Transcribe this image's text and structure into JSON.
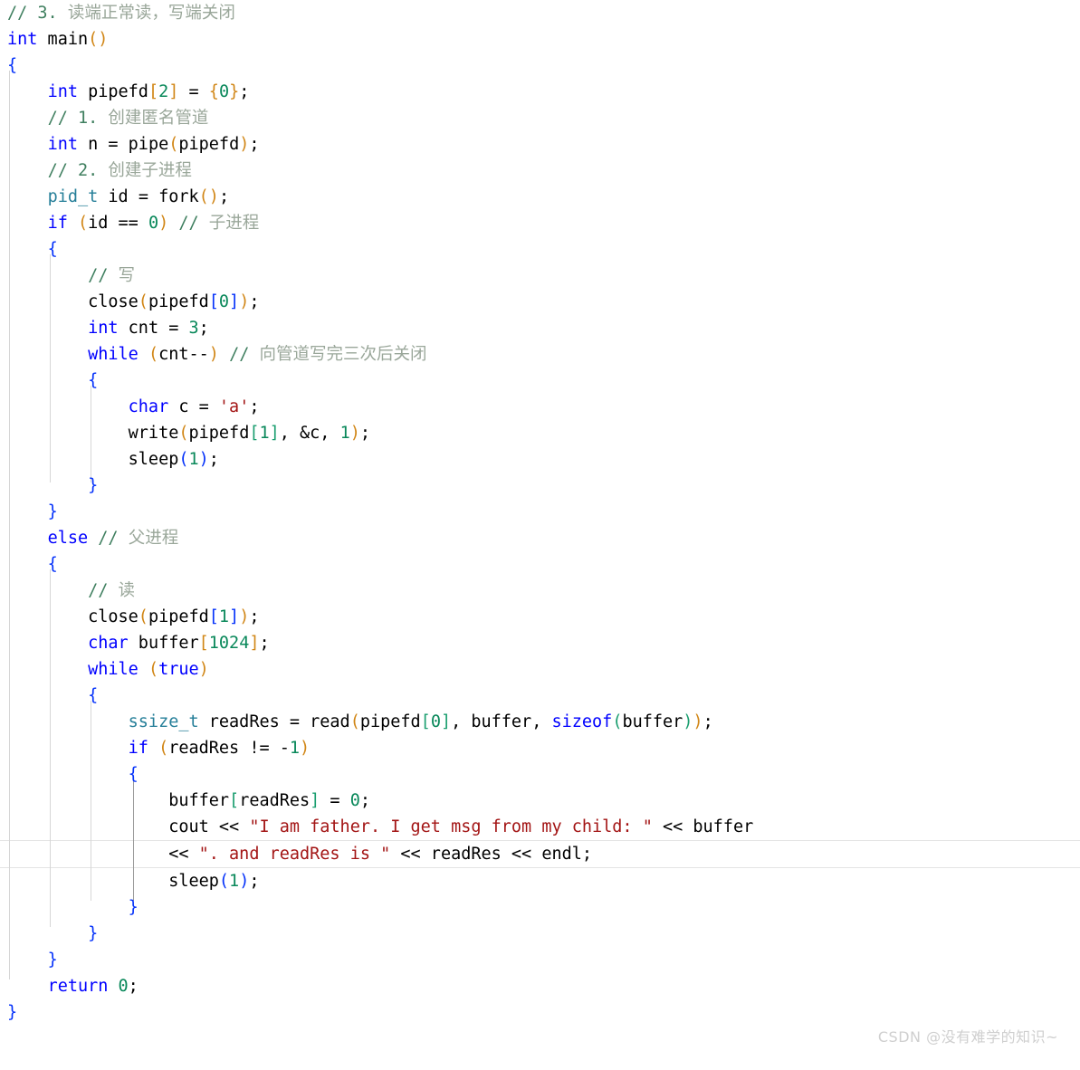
{
  "editor": {
    "language": "cpp",
    "background_color": "#ffffff",
    "highlighted_line_index": 31,
    "colors": {
      "keyword": "#0000ff",
      "type": "#267f99",
      "number": "#09885a",
      "string": "#a31515",
      "comment": "#3f7f5f",
      "comment_cjk": "#9aa79a",
      "plain_text": "#000000",
      "bracket_level_0": "#d18616",
      "bracket_level_1": "#0431fa",
      "bracket_level_2": "#1a9e6f",
      "brace": "#0431fa",
      "indent_guide": "#d6d6d6",
      "indent_guide_active": "#9a9a9a",
      "current_line_border": "#e4e4e4",
      "watermark": "#cfcfcf"
    },
    "lines": [
      "// 3. 读端正常读，写端关闭",
      "int main()",
      "{",
      "    int pipefd[2] = {0};",
      "    // 1. 创建匿名管道",
      "    int n = pipe(pipefd);",
      "    // 2. 创建子进程",
      "    pid_t id = fork();",
      "    if (id == 0) // 子进程",
      "    {",
      "        // 写",
      "        close(pipefd[0]);",
      "        int cnt = 3;",
      "        while (cnt--) // 向管道写完三次后关闭",
      "        {",
      "            char c = 'a';",
      "            write(pipefd[1], &c, 1);",
      "            sleep(1);",
      "        }",
      "    }",
      "    else // 父进程",
      "    {",
      "        // 读",
      "        close(pipefd[1]);",
      "        char buffer[1024];",
      "        while (true)",
      "        {",
      "            ssize_t readRes = read(pipefd[0], buffer, sizeof(buffer));",
      "            if (readRes != -1)",
      "            {",
      "                buffer[readRes] = 0;",
      "                cout << \"I am father. I get msg from my child: \" << buffer",
      "                << \". and readRes is \" << readRes << endl;",
      "                sleep(1);",
      "            }",
      "        }",
      "    }",
      "    return 0;",
      "}"
    ],
    "comments_text": [
      "// 3. 读端正常读，写端关闭",
      "// 1. 创建匿名管道",
      "// 2. 创建子进程",
      "// 子进程",
      "// 写",
      "// 向管道写完三次后关闭",
      "// 父进程",
      "// 读"
    ],
    "string_literals": [
      "'a'",
      "\"I am father. I get msg from my child: \"",
      "\". and readRes is \""
    ],
    "identifiers": [
      "main",
      "pipefd",
      "pipe",
      "n",
      "id",
      "fork",
      "close",
      "cnt",
      "c",
      "write",
      "sleep",
      "buffer",
      "readRes",
      "read",
      "cout",
      "endl"
    ]
  },
  "watermark": {
    "text": "CSDN @没有难学的知识~"
  }
}
